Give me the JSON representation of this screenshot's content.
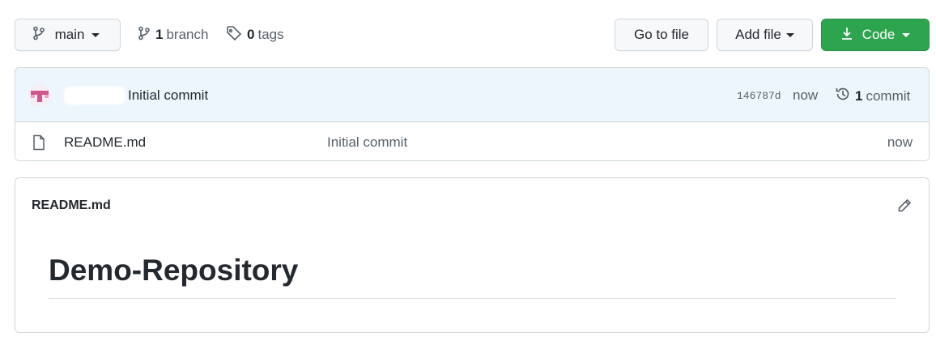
{
  "toolbar": {
    "branch_selector": {
      "label": "main"
    },
    "branches": {
      "count": "1",
      "label": "branch"
    },
    "tags": {
      "count": "0",
      "label": "tags"
    },
    "go_to_file_label": "Go to file",
    "add_file_label": "Add file",
    "code_label": "Code",
    "code_button_color": "#2da44e"
  },
  "latest_commit": {
    "message": "Initial commit",
    "hash": "146787d",
    "time": "now",
    "history": {
      "count": "1",
      "label": "commit"
    }
  },
  "files": [
    {
      "name": "README.md",
      "commit_message": "Initial commit",
      "time": "now",
      "icon": "file-icon"
    }
  ],
  "readme": {
    "filename": "README.md",
    "heading": "Demo-Repository"
  }
}
